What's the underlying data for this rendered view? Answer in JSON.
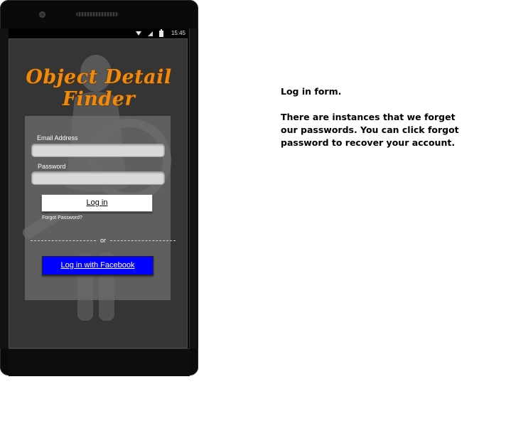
{
  "status_bar": {
    "time": "15:45",
    "icons": [
      "wifi-icon",
      "signal-icon",
      "battery-icon"
    ]
  },
  "app": {
    "title": "Object Detail Finder",
    "title_color": "#f08a0c"
  },
  "form": {
    "email_label": "Email Address",
    "email_value": "",
    "password_label": "Password",
    "password_value": "",
    "login_label": "Log in",
    "forgot_label": "Forgot Password?",
    "divider_text": "or",
    "facebook_label": "Log in with Facebook",
    "facebook_color": "#0000ff"
  },
  "caption": {
    "heading": "Log in form.",
    "body": "There are instances that we forget our passwords. You can click forgot password to recover your account."
  }
}
